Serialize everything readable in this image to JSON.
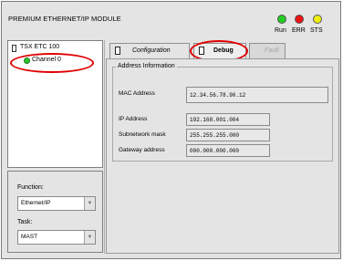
{
  "header": {
    "title": "PREMIUM ETHERNET/IP MODULE",
    "indicators": [
      {
        "label": "Run",
        "color": "#22cc22"
      },
      {
        "label": "ERR",
        "color": "#ee1111"
      },
      {
        "label": "STS",
        "color": "#eeee11"
      }
    ]
  },
  "tree": {
    "root_label": "TSX ETC 100",
    "child_label": "Channel 0",
    "child_status_color": "#2ec82e"
  },
  "settings": {
    "function_label": "Function:",
    "function_value": "Ethernet/IP",
    "task_label": "Task:",
    "task_value": "MAST"
  },
  "tabs": [
    {
      "label": "Configuration",
      "active": false
    },
    {
      "label": "Debug",
      "active": true
    },
    {
      "label": "Fault",
      "active": false,
      "disabled": true
    }
  ],
  "address_info": {
    "group_title": "Address Information",
    "mac_label": "MAC Address",
    "mac_value": "12.34.56.78.90.12",
    "ip_label": "IP Address",
    "ip_value": "192.168.001.004",
    "mask_label": "Subnetwork mask",
    "mask_value": "255.255.255.000",
    "gateway_label": "Gateway address",
    "gateway_value": "000.000.000.000"
  },
  "highlight_color": "#e00000"
}
